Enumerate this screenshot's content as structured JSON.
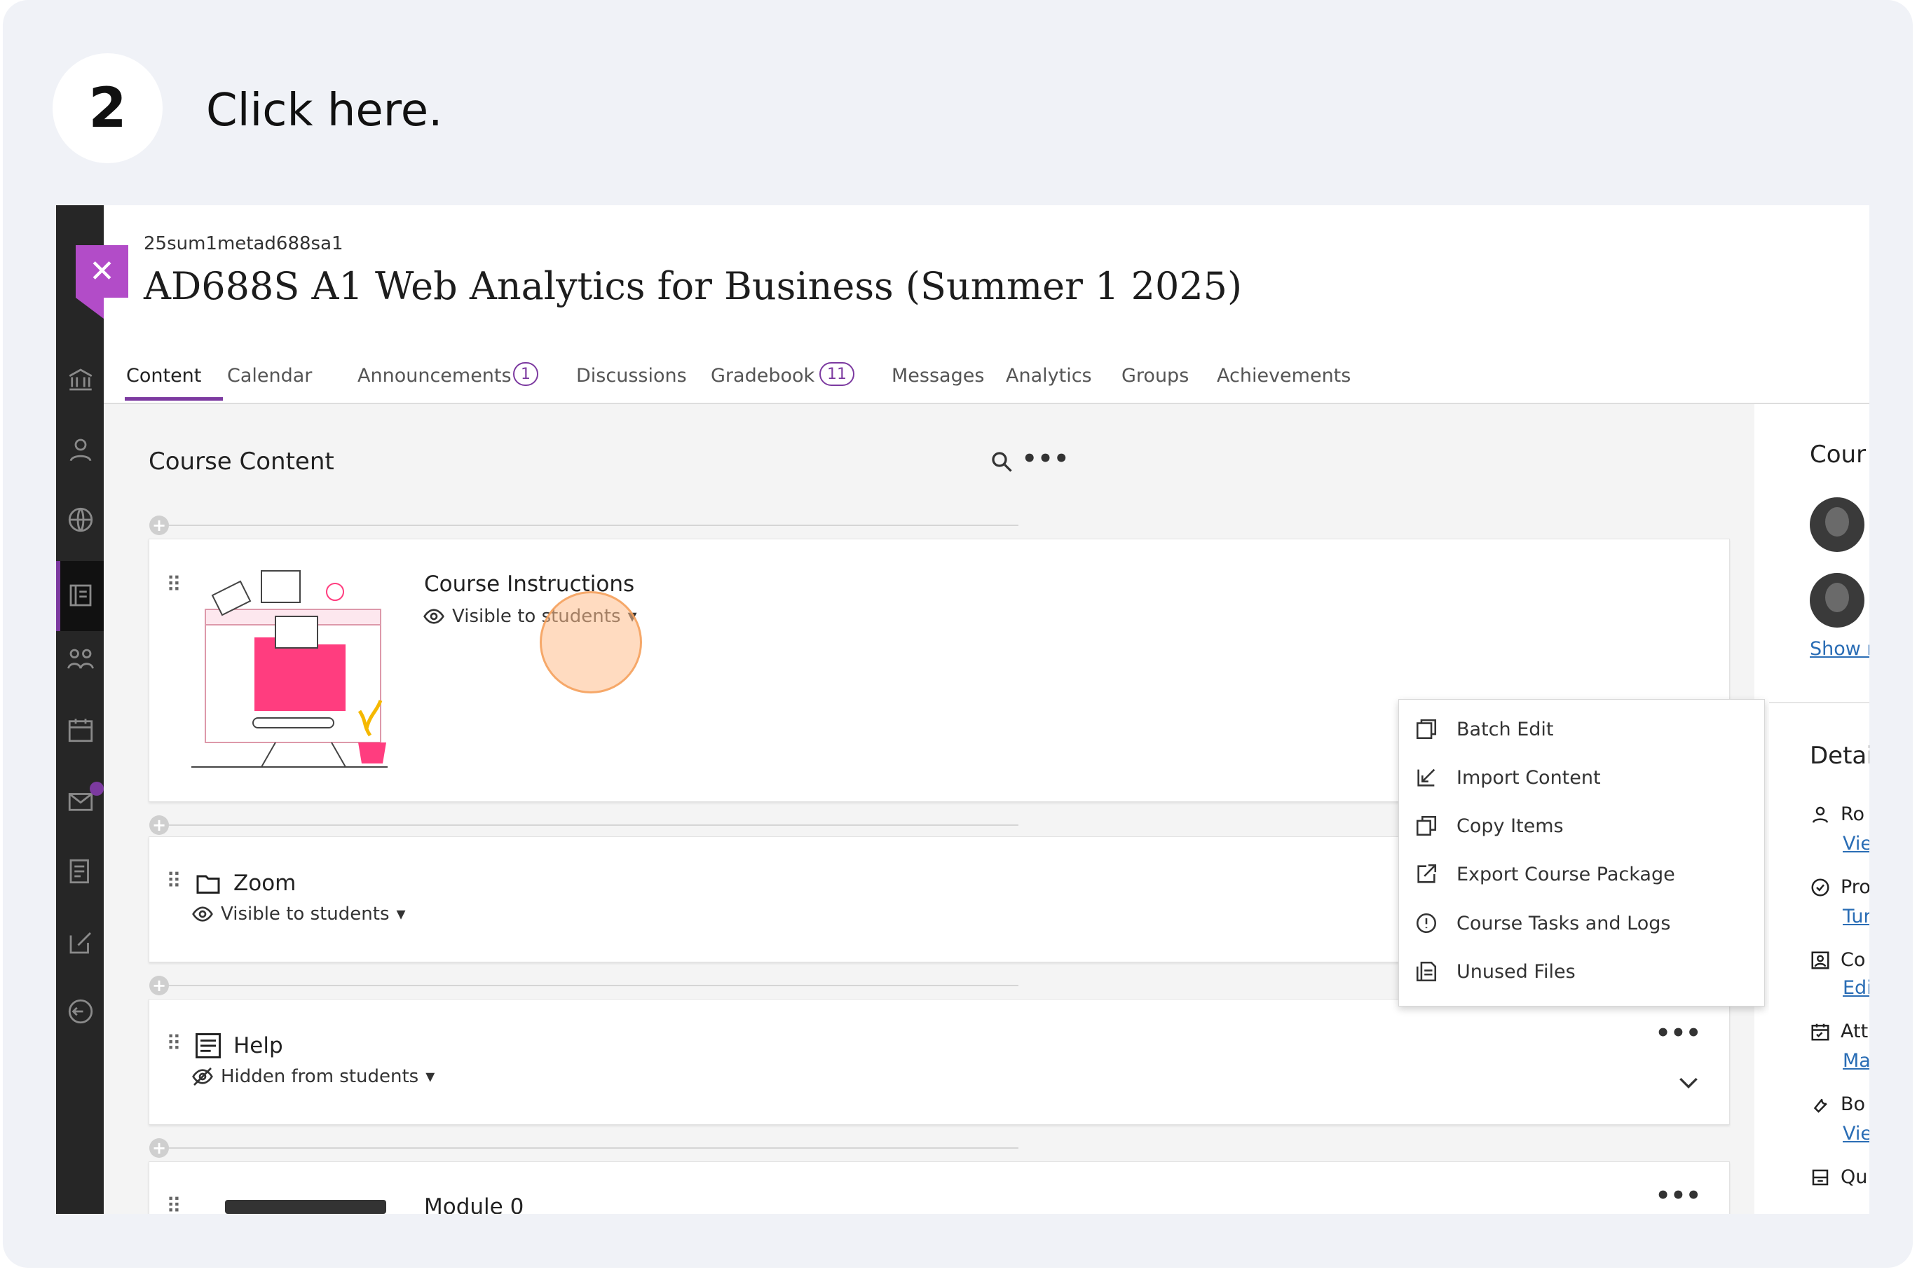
{
  "step": {
    "number": "2",
    "instruction": "Click here."
  },
  "course": {
    "code": "25sum1metad688sa1",
    "title": "AD688S A1 Web Analytics for Business (Summer 1 2025)"
  },
  "tabs": [
    {
      "label": "Content",
      "active": true
    },
    {
      "label": "Calendar"
    },
    {
      "label": "Announcements",
      "badge": "1"
    },
    {
      "label": "Discussions"
    },
    {
      "label": "Gradebook",
      "badge": "11"
    },
    {
      "label": "Messages"
    },
    {
      "label": "Analytics"
    },
    {
      "label": "Groups"
    },
    {
      "label": "Achievements"
    }
  ],
  "content": {
    "heading": "Course Content",
    "items": [
      {
        "title": "Course Instructions",
        "visibility": "Visible to students"
      },
      {
        "title": "Zoom",
        "visibility": "Visible to students"
      },
      {
        "title": "Help",
        "visibility": "Hidden from students"
      },
      {
        "title": "Module 0"
      }
    ]
  },
  "menu": {
    "items": [
      "Batch Edit",
      "Import Content",
      "Copy Items",
      "Export Course Package",
      "Course Tasks and Logs",
      "Unused Files"
    ]
  },
  "right_panel": {
    "section1": "Cour",
    "show_more": "Show r",
    "section2": "Detai",
    "rows": [
      {
        "label": "Ro",
        "link": "Vie"
      },
      {
        "label": "Pro",
        "link": "Tur"
      },
      {
        "label": "Co",
        "link": "Edi"
      },
      {
        "label": "Att",
        "link": "Ma"
      },
      {
        "label": "Bo",
        "link": "Vie"
      },
      {
        "label": "Qu"
      }
    ]
  },
  "colors": {
    "accent": "#7c3aa0",
    "close_tile": "#b24cc8",
    "link": "#2a6db5",
    "click_marker": "#f5a05a"
  }
}
